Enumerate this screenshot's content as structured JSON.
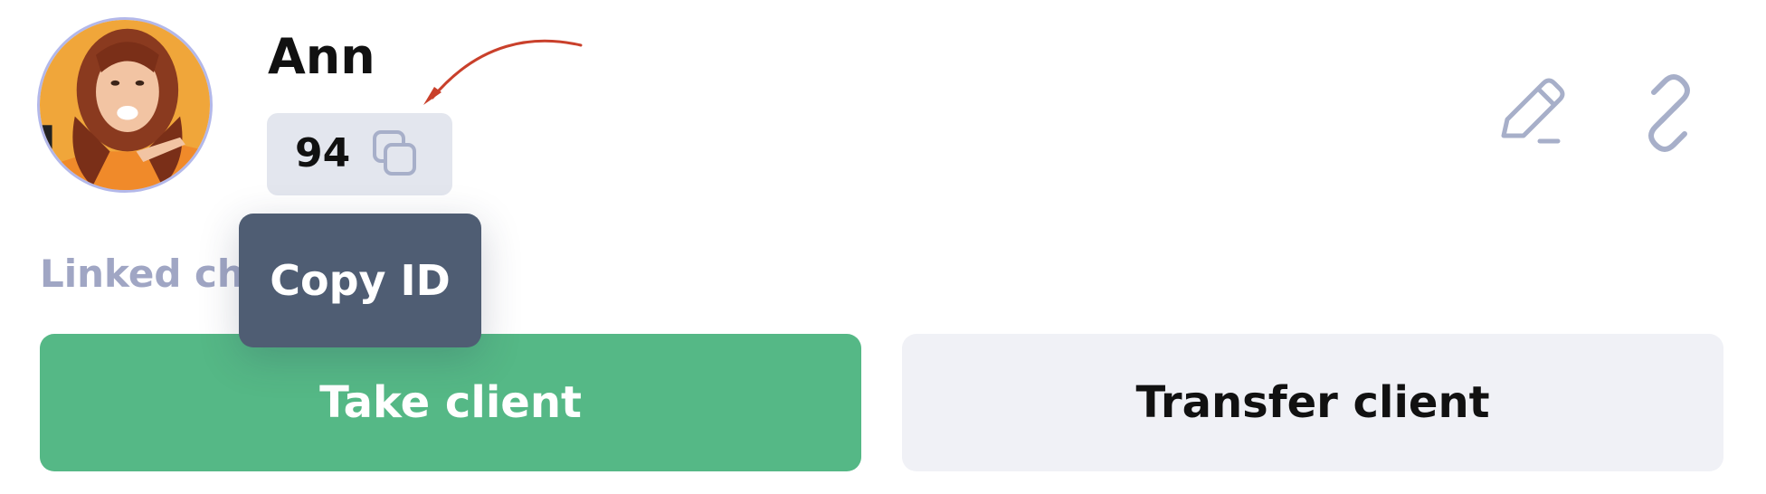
{
  "client": {
    "name": "Ann",
    "id": "94"
  },
  "tooltip": {
    "text": "Copy ID"
  },
  "linked_chats": {
    "label": "Linked cha"
  },
  "actions": {
    "take_label": "Take client",
    "transfer_label": "Transfer client"
  },
  "icons": {
    "copy": "copy-icon",
    "edit": "pencil-icon",
    "link": "link-icon",
    "annotation": "curved-arrow-icon"
  },
  "colors": {
    "take_button": "#55b886",
    "transfer_button": "#f0f1f6",
    "tooltip_bg": "#4f5d73",
    "id_chip_bg": "#e3e6ee",
    "icon_stroke": "#a7afc9",
    "annotation_arrow": "#c9402b",
    "avatar_border": "#b3b8ea"
  }
}
